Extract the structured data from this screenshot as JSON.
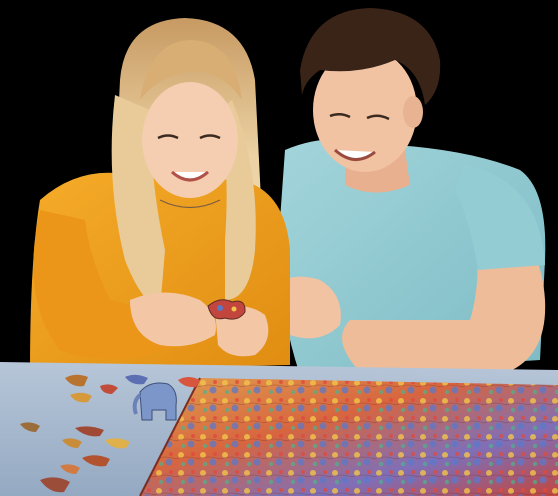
{
  "image": {
    "description_free": true
  },
  "palette": {
    "background": "#000000",
    "table": "#9fb4cc",
    "sweater": "#f2a11e",
    "tshirt": "#8fc8cf",
    "hair_woman": "#e2c08f",
    "hair_man": "#3a2418",
    "skin": "#f1c3a3",
    "puzzle_base": "#d9744a"
  }
}
